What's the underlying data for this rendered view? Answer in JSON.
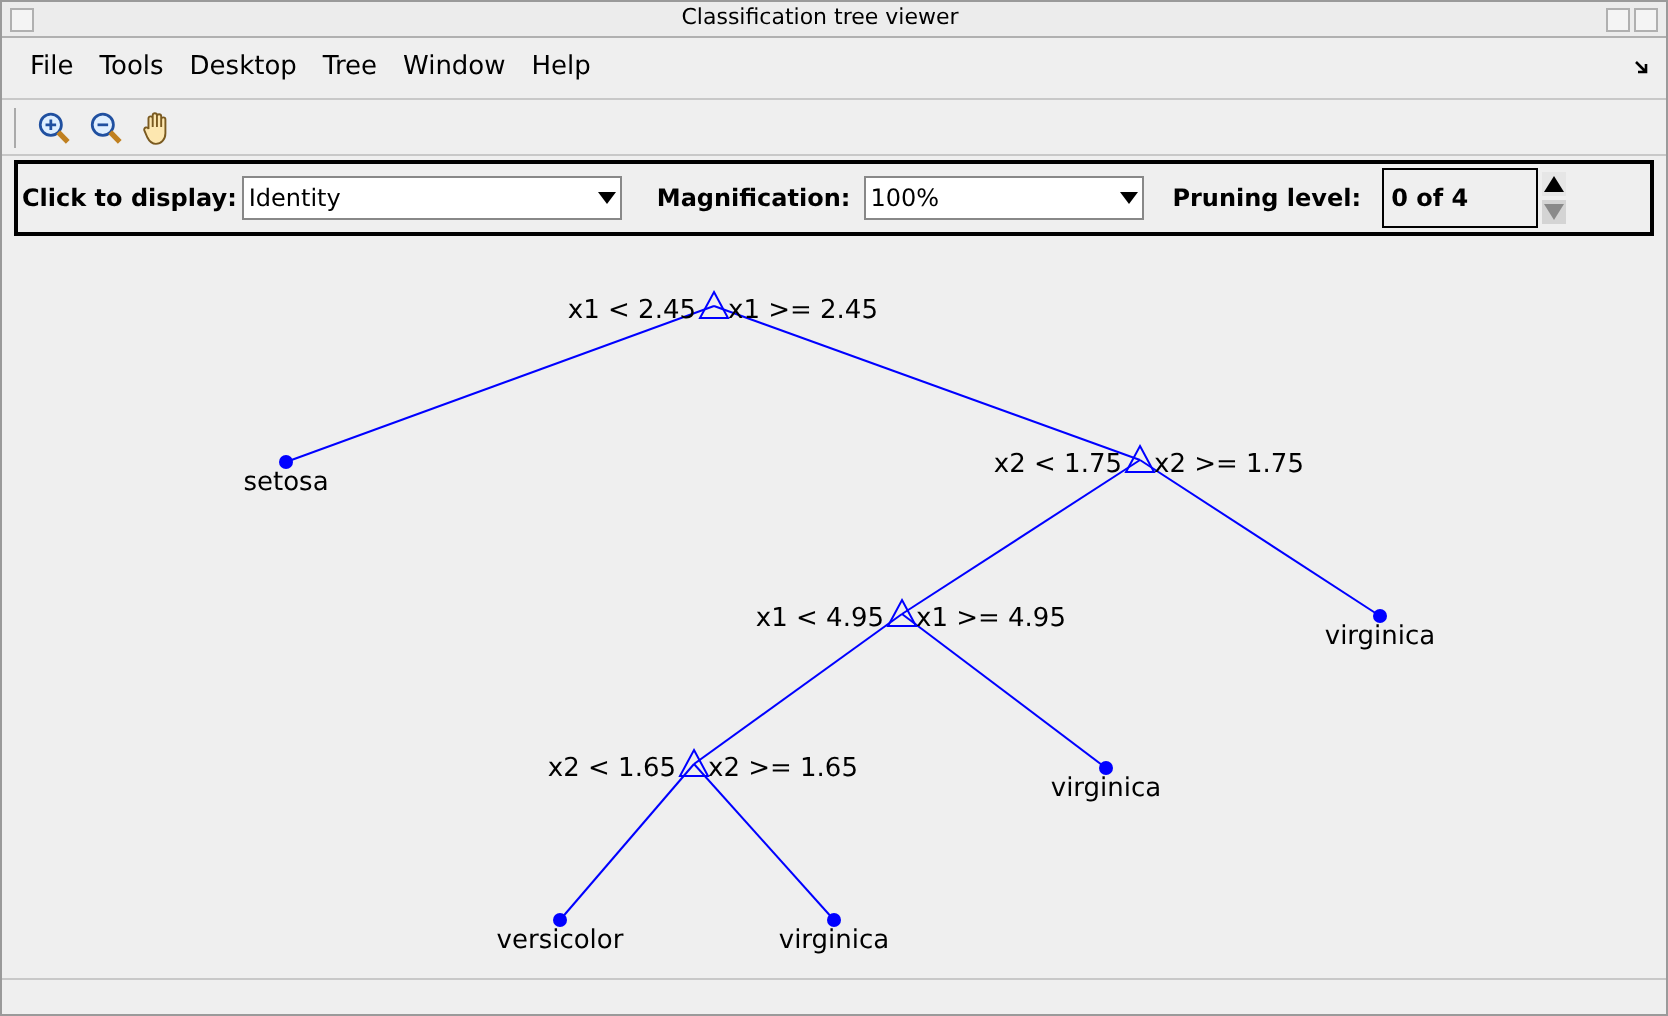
{
  "window": {
    "title": "Classification tree viewer"
  },
  "menu": [
    "File",
    "Tools",
    "Desktop",
    "Tree",
    "Window",
    "Help"
  ],
  "toolbar": [
    {
      "kind": "zoom_in"
    },
    {
      "kind": "zoom_out"
    },
    {
      "kind": "pan"
    }
  ],
  "controls": {
    "display_label": "Click to display:",
    "display_value": "Identity",
    "magnification_label": "Magnification:",
    "magnification_value": "100%",
    "pruning_label": "Pruning level:",
    "pruning_value": "0 of 4"
  },
  "tree": {
    "kind": "split",
    "left": "x1 < 2.45",
    "right": "x1 >= 2.45",
    "children": [
      {
        "kind": "leaf",
        "label": "setosa"
      },
      {
        "kind": "split",
        "left": "x2 < 1.75",
        "right": "x2 >= 1.75",
        "children": [
          {
            "kind": "split",
            "left": "x1 < 4.95",
            "right": "x1 >= 4.95",
            "children": [
              {
                "kind": "split",
                "left": "x2 < 1.65",
                "right": "x2 >= 1.65",
                "children": [
                  {
                    "kind": "leaf",
                    "label": "versicolor"
                  },
                  {
                    "kind": "leaf",
                    "label": "virginica"
                  }
                ]
              },
              {
                "kind": "leaf",
                "label": "virginica"
              }
            ]
          },
          {
            "kind": "leaf",
            "label": "virginica"
          }
        ]
      }
    ]
  }
}
